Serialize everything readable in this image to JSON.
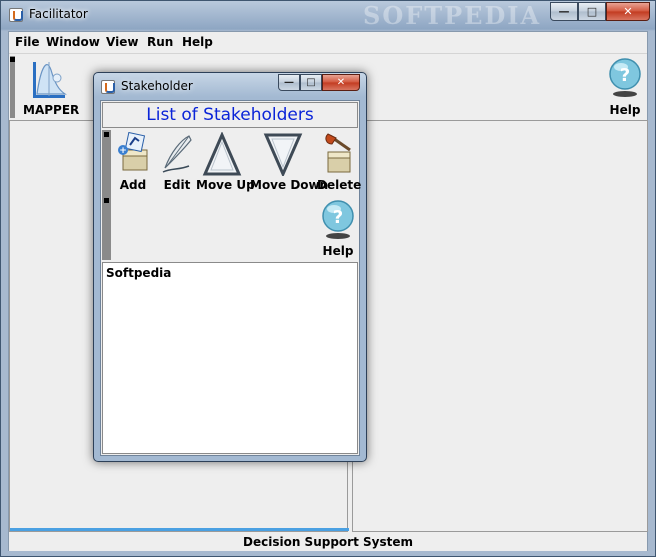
{
  "window": {
    "title": "Facilitator",
    "watermark": "SOFTPEDIA"
  },
  "menubar": {
    "items": [
      "File",
      "Window",
      "View",
      "Run",
      "Help"
    ]
  },
  "toolbar": {
    "mapper_label": "MAPPER",
    "help_label": "Help"
  },
  "status": {
    "text": "Decision Support System"
  },
  "dialog": {
    "title": "Stakeholder",
    "header": "List of Stakeholders",
    "tools": {
      "add": "Add",
      "edit": "Edit",
      "move_up": "Move Up",
      "move_down": "Move Down",
      "delete": "Delete",
      "help": "Help"
    },
    "entries": [
      "Softpedia"
    ]
  },
  "colors": {
    "header_text": "#0a24d8",
    "accent_bar": "#4aa0e2",
    "title_close": "#c23a20"
  },
  "icons": [
    "app-icon",
    "mapper-icon",
    "help-icon",
    "add-icon",
    "edit-icon",
    "move-up-icon",
    "move-down-icon",
    "delete-icon",
    "minimize-icon",
    "maximize-icon",
    "close-icon"
  ]
}
